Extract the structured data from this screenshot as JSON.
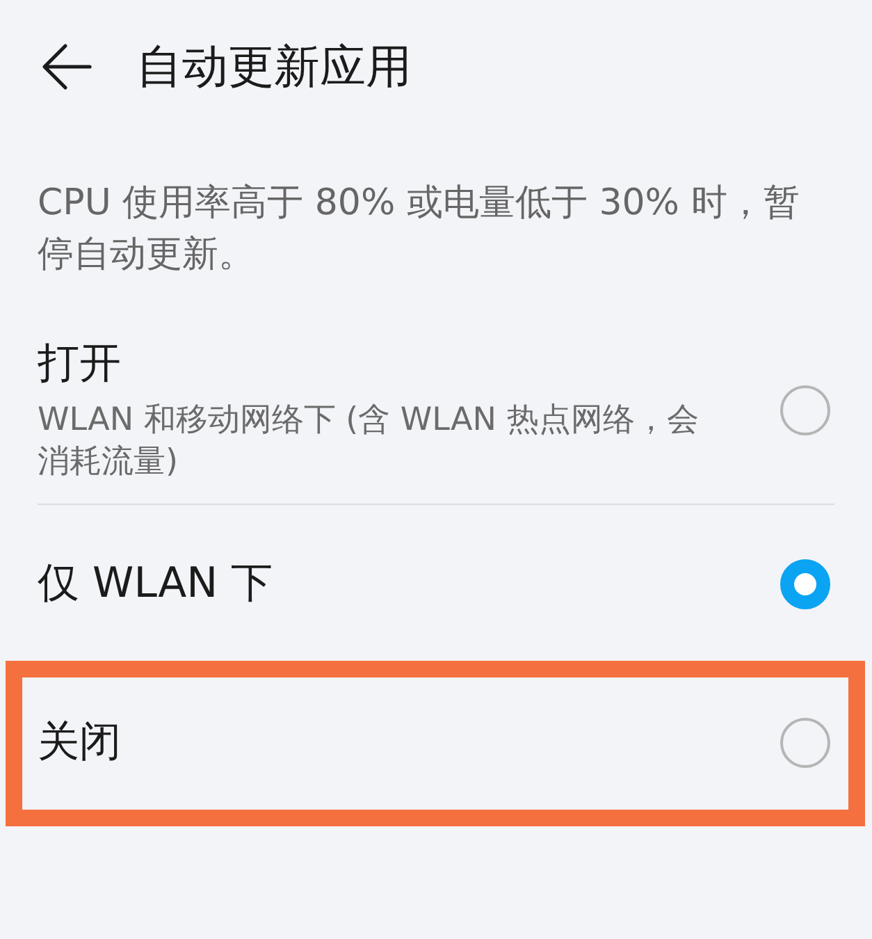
{
  "app_bar": {
    "title": "自动更新应用"
  },
  "description": "CPU 使用率高于 80% 或电量低于 30% 时，暂停自动更新。",
  "options": [
    {
      "title": "打开",
      "subtitle": "WLAN 和移动网络下 (含 WLAN 热点网络，会消耗流量)",
      "selected": false,
      "highlighted": false
    },
    {
      "title": "仅 WLAN 下",
      "selected": true,
      "highlighted": false
    },
    {
      "title": "关闭",
      "selected": false,
      "highlighted": true
    }
  ]
}
